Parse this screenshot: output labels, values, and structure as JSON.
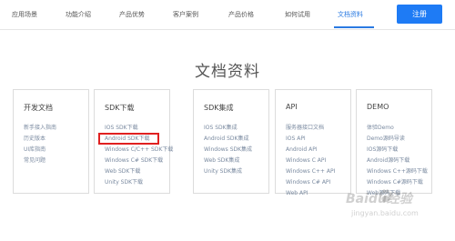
{
  "nav": {
    "items": [
      "应用场景",
      "功能介绍",
      "产品优势",
      "客户案例",
      "产品价格",
      "如何试用",
      "文档资料"
    ],
    "active_index": 6,
    "register_label": "注册",
    "accent_color": "#1e7bf5"
  },
  "page": {
    "title": "文档资料"
  },
  "cards": [
    {
      "title": "开发文档",
      "links": [
        "新手接入指南",
        "历史版本",
        "UI库指南",
        "常见问题"
      ]
    },
    {
      "title": "SDK下载",
      "links": [
        "IOS SDK下载",
        "Android SDK下载",
        "Windows C/C++ SDK下载",
        "Windows C# SDK下载",
        "Web SDK下载",
        "Unity SDK下载"
      ]
    },
    {
      "title": "SDK集成",
      "links": [
        "IOS SDK集成",
        "Android SDK集成",
        "Windows SDK集成",
        "Web SDK集成",
        "Unity SDK集成"
      ]
    },
    {
      "title": "API",
      "links": [
        "服务器接口文档",
        "IOS API",
        "Android API",
        "Windows C API",
        "Windows C++ API",
        "Windows C# API",
        "Web API"
      ]
    },
    {
      "title": "DEMO",
      "links": [
        "体验Demo",
        "Demo源码导读",
        "IOS源码下载",
        "Android源码下载",
        "Windows C++源码下载",
        "Windows C#源码下载",
        "Web源码下载"
      ]
    }
  ],
  "highlight": {
    "card_index": 1,
    "link_index": 1,
    "color": "#e02020"
  },
  "watermark": {
    "text": "Baidu经验",
    "sub": "jingyan.baidu.com"
  }
}
